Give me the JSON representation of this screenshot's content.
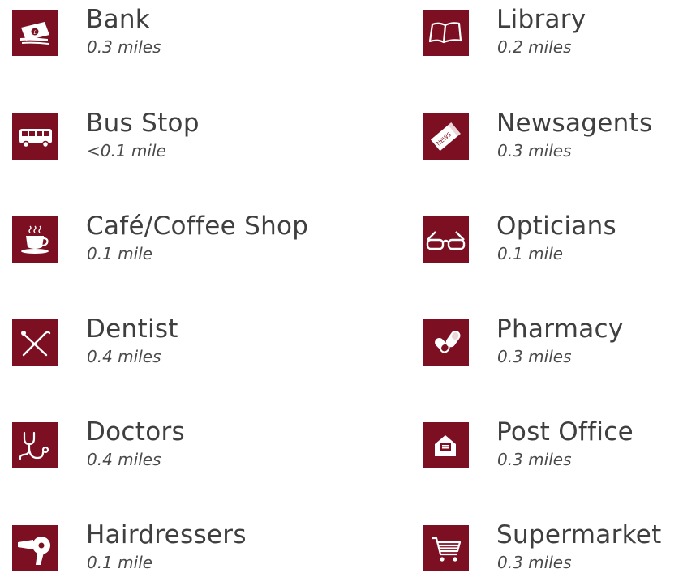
{
  "theme": {
    "icon_bg": "#7d0f22",
    "text": "#3f3f3f"
  },
  "amenities": [
    {
      "name": "Bank",
      "distance": "0.3 miles",
      "icon": "banknote-icon"
    },
    {
      "name": "Library",
      "distance": "0.2 miles",
      "icon": "book-icon"
    },
    {
      "name": "Bus Stop",
      "distance": "<0.1 mile",
      "icon": "bus-icon"
    },
    {
      "name": "Newsagents",
      "distance": "0.3 miles",
      "icon": "newspaper-icon"
    },
    {
      "name": "Café/Coffee Shop",
      "distance": "0.1 mile",
      "icon": "coffee-cup-icon"
    },
    {
      "name": "Opticians",
      "distance": "0.1 mile",
      "icon": "glasses-icon"
    },
    {
      "name": "Dentist",
      "distance": "0.4 miles",
      "icon": "dental-tools-icon"
    },
    {
      "name": "Pharmacy",
      "distance": "0.3 miles",
      "icon": "pills-icon"
    },
    {
      "name": "Doctors",
      "distance": "0.4 miles",
      "icon": "stethoscope-icon"
    },
    {
      "name": "Post Office",
      "distance": "0.3 miles",
      "icon": "envelope-icon"
    },
    {
      "name": "Hairdressers",
      "distance": "0.1 mile",
      "icon": "hairdryer-icon"
    },
    {
      "name": "Supermarket",
      "distance": "0.3 miles",
      "icon": "shopping-cart-icon"
    }
  ]
}
